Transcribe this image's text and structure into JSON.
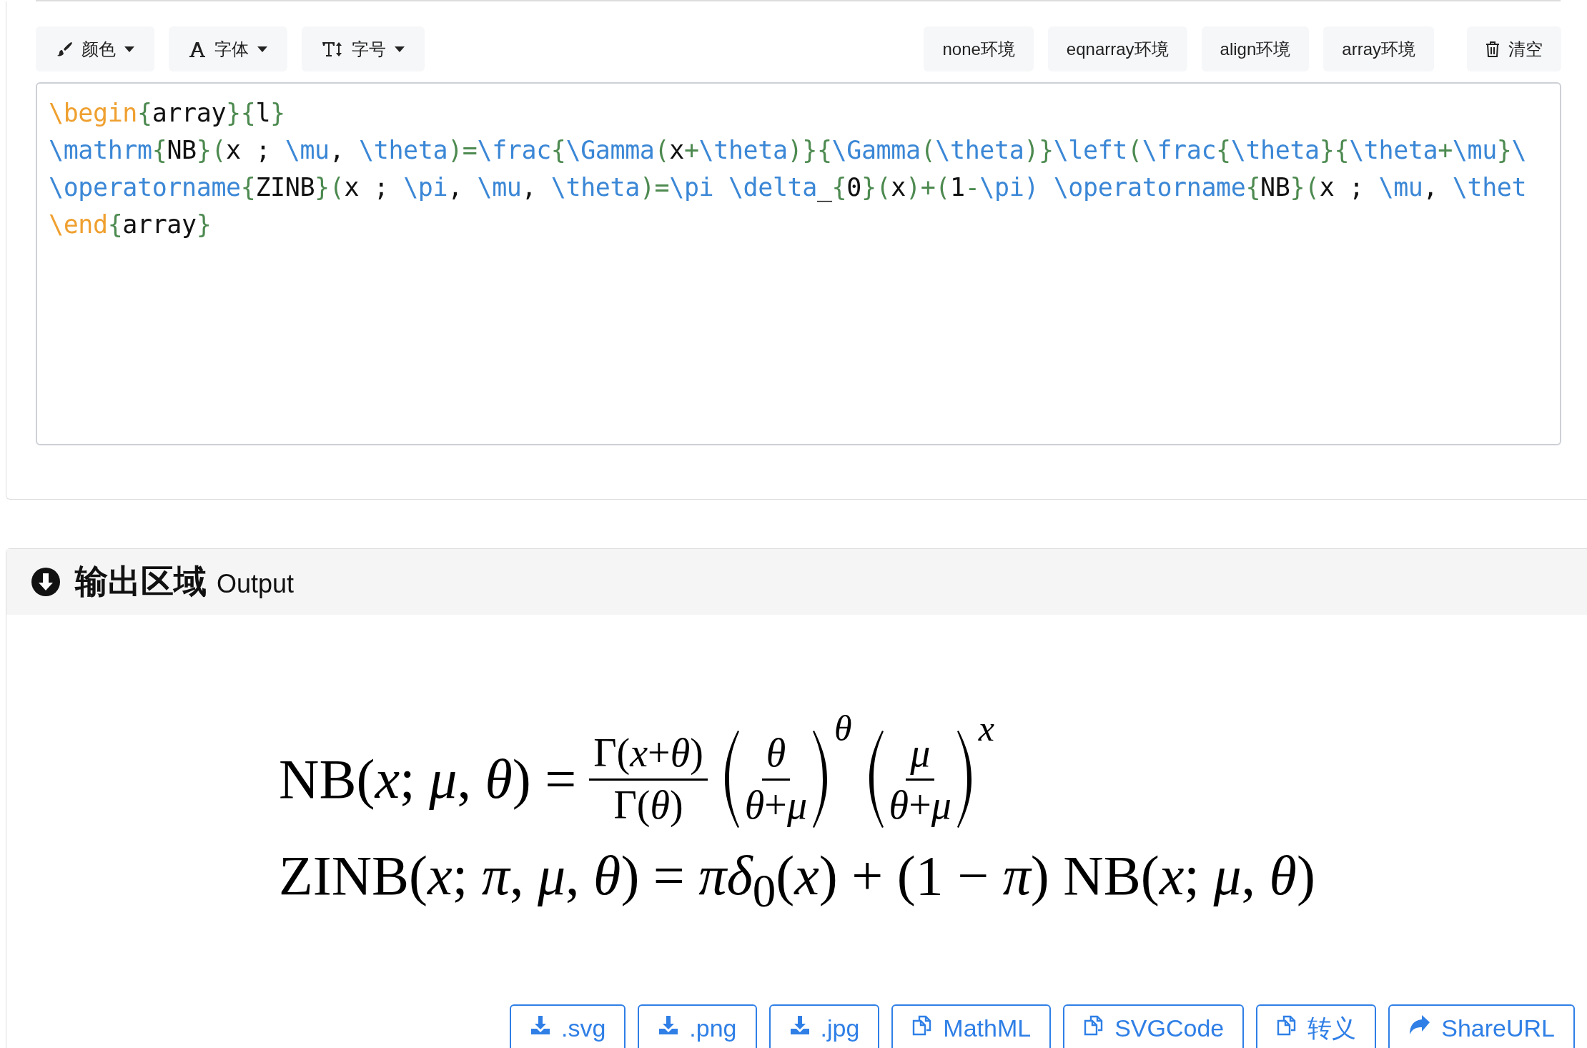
{
  "toolbar": {
    "menus": [
      {
        "kind": "brush",
        "label": "颜色"
      },
      {
        "kind": "font",
        "label": "字体"
      },
      {
        "kind": "size",
        "label": "字号"
      }
    ],
    "environments": [
      "none环境",
      "eqnarray环境",
      "align环境",
      "array环境"
    ],
    "clear": "清空"
  },
  "editor": {
    "lines": [
      [
        {
          "kind": "kw",
          "text": "\\begin"
        },
        {
          "kind": "br",
          "text": "{"
        },
        {
          "kind": "tx",
          "text": "array"
        },
        {
          "kind": "br",
          "text": "}{"
        },
        {
          "kind": "tx",
          "text": "l"
        },
        {
          "kind": "br",
          "text": "}"
        }
      ],
      [
        {
          "kind": "cmd",
          "text": "\\mathrm"
        },
        {
          "kind": "br",
          "text": "{"
        },
        {
          "kind": "tx",
          "text": "NB"
        },
        {
          "kind": "br",
          "text": "}("
        },
        {
          "kind": "tx",
          "text": "x ; "
        },
        {
          "kind": "cmd",
          "text": "\\mu"
        },
        {
          "kind": "tx",
          "text": ", "
        },
        {
          "kind": "cmd",
          "text": "\\theta"
        },
        {
          "kind": "br",
          "text": ")="
        },
        {
          "kind": "cmd",
          "text": "\\frac"
        },
        {
          "kind": "br",
          "text": "{"
        },
        {
          "kind": "cmd",
          "text": "\\Gamma"
        },
        {
          "kind": "br",
          "text": "("
        },
        {
          "kind": "tx",
          "text": "x"
        },
        {
          "kind": "br",
          "text": "+"
        },
        {
          "kind": "cmd",
          "text": "\\theta"
        },
        {
          "kind": "br",
          "text": ")}{"
        },
        {
          "kind": "cmd",
          "text": "\\Gamma"
        },
        {
          "kind": "br",
          "text": "("
        },
        {
          "kind": "cmd",
          "text": "\\theta"
        },
        {
          "kind": "br",
          "text": ")}"
        },
        {
          "kind": "cmd",
          "text": "\\left"
        },
        {
          "kind": "br",
          "text": "("
        },
        {
          "kind": "cmd",
          "text": "\\frac"
        },
        {
          "kind": "br",
          "text": "{"
        },
        {
          "kind": "cmd",
          "text": "\\theta"
        },
        {
          "kind": "br",
          "text": "}{"
        },
        {
          "kind": "cmd",
          "text": "\\theta"
        },
        {
          "kind": "br",
          "text": "+"
        },
        {
          "kind": "cmd",
          "text": "\\mu"
        },
        {
          "kind": "br",
          "text": "}"
        },
        {
          "kind": "cmd",
          "text": "\\"
        }
      ],
      [
        {
          "kind": "cmd",
          "text": "\\operatorname"
        },
        {
          "kind": "br",
          "text": "{"
        },
        {
          "kind": "tx",
          "text": "ZINB"
        },
        {
          "kind": "br",
          "text": "}("
        },
        {
          "kind": "tx",
          "text": "x ; "
        },
        {
          "kind": "cmd",
          "text": "\\pi"
        },
        {
          "kind": "tx",
          "text": ", "
        },
        {
          "kind": "cmd",
          "text": "\\mu"
        },
        {
          "kind": "tx",
          "text": ", "
        },
        {
          "kind": "cmd",
          "text": "\\theta"
        },
        {
          "kind": "br",
          "text": ")="
        },
        {
          "kind": "cmd",
          "text": "\\pi \\delta"
        },
        {
          "kind": "tx",
          "text": "_"
        },
        {
          "kind": "br",
          "text": "{"
        },
        {
          "kind": "tx",
          "text": "0"
        },
        {
          "kind": "br",
          "text": "}("
        },
        {
          "kind": "tx",
          "text": "x"
        },
        {
          "kind": "br",
          "text": ")+("
        },
        {
          "kind": "tx",
          "text": "1"
        },
        {
          "kind": "br",
          "text": "-"
        },
        {
          "kind": "cmd",
          "text": "\\pi)"
        },
        {
          "kind": "cmd",
          "text": " \\operatorname"
        },
        {
          "kind": "br",
          "text": "{"
        },
        {
          "kind": "tx",
          "text": "NB"
        },
        {
          "kind": "br",
          "text": "}("
        },
        {
          "kind": "tx",
          "text": "x ; "
        },
        {
          "kind": "cmd",
          "text": "\\mu"
        },
        {
          "kind": "tx",
          "text": ", "
        },
        {
          "kind": "cmd",
          "text": "\\thet"
        }
      ],
      [
        {
          "kind": "kw",
          "text": "\\end"
        },
        {
          "kind": "br",
          "text": "{"
        },
        {
          "kind": "tx",
          "text": "array"
        },
        {
          "kind": "br",
          "text": "}"
        }
      ]
    ]
  },
  "output": {
    "title": "输出区域",
    "subtitle": "Output",
    "formula": [
      [
        {
          "kind": "math",
          "text": "NB(*x*; *μ*, *θ*) ="
        },
        {
          "kind": "frac",
          "num": "Γ(*x*+*θ*)",
          "den": "Γ(*θ*)"
        },
        {
          "kind": "power",
          "num": "*θ*",
          "den": "*θ*+*μ*",
          "exp": "*θ*"
        },
        {
          "kind": "power",
          "num": "*μ*",
          "den": "*θ*+*μ*",
          "exp": "*x*"
        }
      ],
      [
        {
          "kind": "math",
          "text": "ZINB(*x*; *π*, *μ*, *θ*) = *πδ*$_{0}$(*x*) + (1 − *π*) NB(*x*; *μ*, *θ*)"
        }
      ]
    ],
    "buttons": [
      {
        "kind": "download",
        "label": ".svg"
      },
      {
        "kind": "download",
        "label": ".png"
      },
      {
        "kind": "download",
        "label": ".jpg"
      },
      {
        "kind": "copy",
        "label": "MathML"
      },
      {
        "kind": "copy",
        "label": "SVGCode"
      },
      {
        "kind": "copy",
        "label": "转义"
      },
      {
        "kind": "share",
        "label": "ShareURL"
      }
    ]
  }
}
